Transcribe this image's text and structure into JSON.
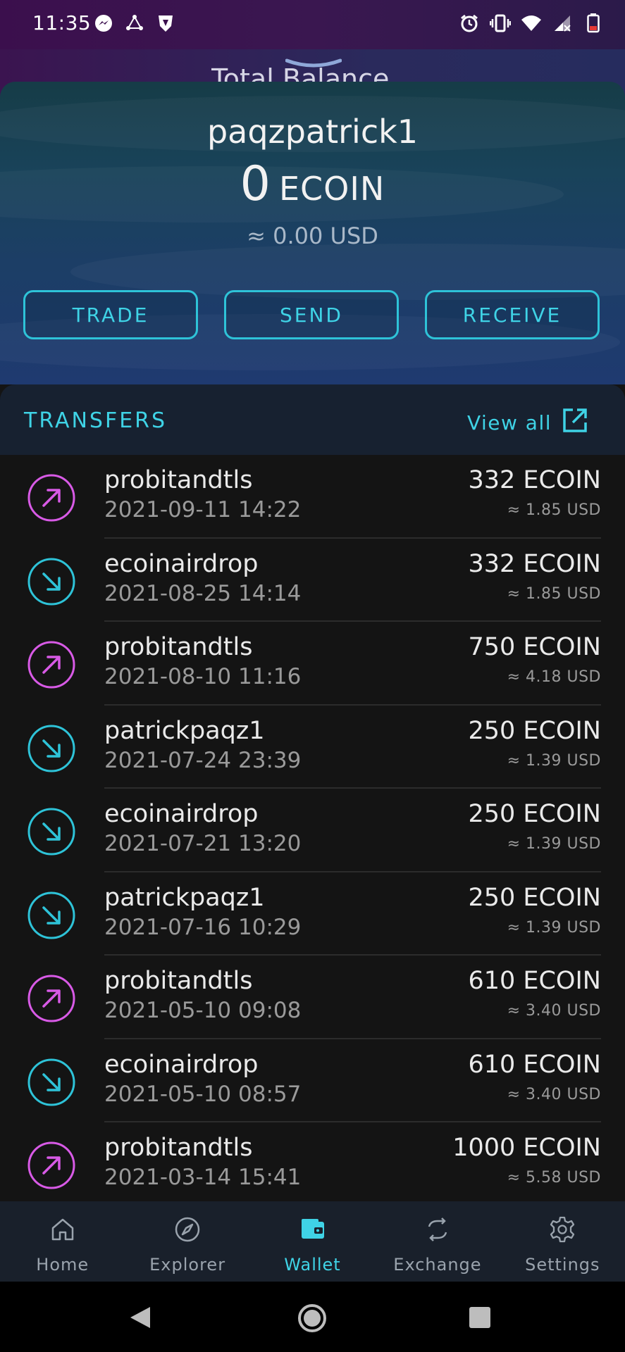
{
  "status_bar": {
    "time": "11:35",
    "left_icons": [
      "messenger-icon",
      "sync-icon",
      "brave-icon"
    ],
    "right_icons": [
      "alarm-icon",
      "vibrate-icon",
      "wifi-icon",
      "signal-icon",
      "battery-icon"
    ]
  },
  "header": {
    "ghost_title": "Total Balance"
  },
  "balance": {
    "username": "paqzpatrick1",
    "amount": "0",
    "unit": "ECOIN",
    "usd": "≈ 0.00 USD"
  },
  "actions": {
    "trade": "TRADE",
    "send": "SEND",
    "receive": "RECEIVE"
  },
  "transfers": {
    "title": "TRANSFERS",
    "view_all": "View all",
    "items": [
      {
        "direction": "out",
        "name": "probitandtls",
        "date": "2021-09-11 14:22",
        "amount": "332 ECOIN",
        "usd": "≈ 1.85 USD"
      },
      {
        "direction": "in",
        "name": "ecoinairdrop",
        "date": "2021-08-25 14:14",
        "amount": "332 ECOIN",
        "usd": "≈ 1.85 USD"
      },
      {
        "direction": "out",
        "name": "probitandtls",
        "date": "2021-08-10 11:16",
        "amount": "750 ECOIN",
        "usd": "≈ 4.18 USD"
      },
      {
        "direction": "in",
        "name": "patrickpaqz1",
        "date": "2021-07-24 23:39",
        "amount": "250 ECOIN",
        "usd": "≈ 1.39 USD"
      },
      {
        "direction": "in",
        "name": "ecoinairdrop",
        "date": "2021-07-21 13:20",
        "amount": "250 ECOIN",
        "usd": "≈ 1.39 USD"
      },
      {
        "direction": "in",
        "name": "patrickpaqz1",
        "date": "2021-07-16 10:29",
        "amount": "250 ECOIN",
        "usd": "≈ 1.39 USD"
      },
      {
        "direction": "out",
        "name": "probitandtls",
        "date": "2021-05-10 09:08",
        "amount": "610 ECOIN",
        "usd": "≈ 3.40 USD"
      },
      {
        "direction": "in",
        "name": "ecoinairdrop",
        "date": "2021-05-10 08:57",
        "amount": "610 ECOIN",
        "usd": "≈ 3.40 USD"
      },
      {
        "direction": "out",
        "name": "probitandtls",
        "date": "2021-03-14 15:41",
        "amount": "1000 ECOIN",
        "usd": "≈ 5.58 USD"
      }
    ]
  },
  "nav": {
    "items": [
      {
        "label": "Home",
        "icon": "home-icon"
      },
      {
        "label": "Explorer",
        "icon": "compass-icon"
      },
      {
        "label": "Wallet",
        "icon": "wallet-icon",
        "active": true
      },
      {
        "label": "Exchange",
        "icon": "exchange-icon"
      },
      {
        "label": "Settings",
        "icon": "gear-icon"
      }
    ]
  },
  "colors": {
    "accent": "#3fd3e6",
    "outgoing": "#d85ae6",
    "incoming": "#2ec3d8"
  }
}
